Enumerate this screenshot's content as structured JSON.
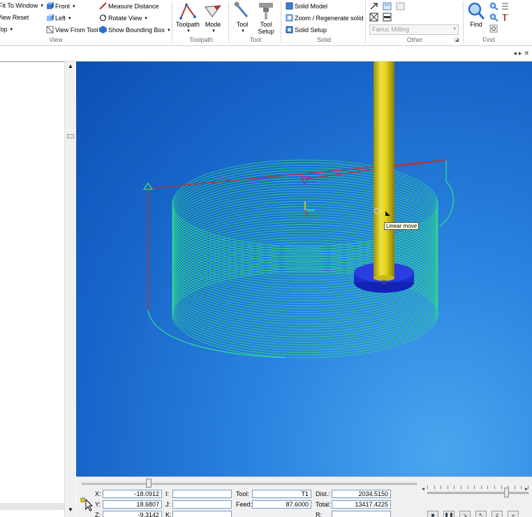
{
  "ribbon": {
    "view": {
      "fit_to_window": "Fit To Window",
      "view_reset": "View Reset",
      "top": "Top",
      "front": "Front",
      "left": "Left",
      "view_from_tool": "View From Tool",
      "measure_distance": "Measure Distance",
      "rotate_view": "Rotate View",
      "show_bounding_box": "Show Bounding Box",
      "group_label": "View"
    },
    "toolpath": {
      "toolpath": "Toolpath",
      "mode": "Mode",
      "group_label": "Toolpath"
    },
    "tool": {
      "tool": "Tool",
      "tool_setup_line1": "Tool",
      "tool_setup_line2": "Setup",
      "group_label": "Tool"
    },
    "solid": {
      "solid_model": "Solid Model",
      "zoom_regenerate": "Zoom / Regenerate solid",
      "solid_setup": "Solid Setup",
      "group_label": "Solid"
    },
    "other": {
      "post_selector": "Fanuc Milling",
      "group_label": "Other"
    },
    "find": {
      "find": "Find",
      "group_label": "Find"
    }
  },
  "viewport": {
    "tooltip": "Linear move",
    "colors": {
      "toolpath": "#2ee08a",
      "rapid": "#c0302a",
      "tool_shank": "#e5d21a",
      "tool_holder": "#1c33d8"
    }
  },
  "status": {
    "x_label": "X:",
    "x_value": "-18.0912",
    "y_label": "Y:",
    "y_value": "18.6807",
    "z_label": "Z:",
    "z_value": "-9.3142",
    "i_label": "I:",
    "i_value": "",
    "j_label": "J:",
    "j_value": "",
    "k_label": "K:",
    "k_value": "",
    "tool_label": "Tool:",
    "tool_value": "T1",
    "feed_label": "Feed:",
    "feed_value": "87.6000",
    "dist_label": "Dist.:",
    "dist_value": "2034.5150",
    "total_label": "Total:",
    "total_value": "13417.4225",
    "r_label": "R:",
    "r_value": ""
  },
  "playback": {
    "simulation_progress": 0.2,
    "speed_level": 0.78,
    "buttons": [
      "stop-icon",
      "pause-icon",
      "step-icon",
      "step-back-icon",
      "move-z-icon",
      "fast-forward-icon"
    ]
  }
}
